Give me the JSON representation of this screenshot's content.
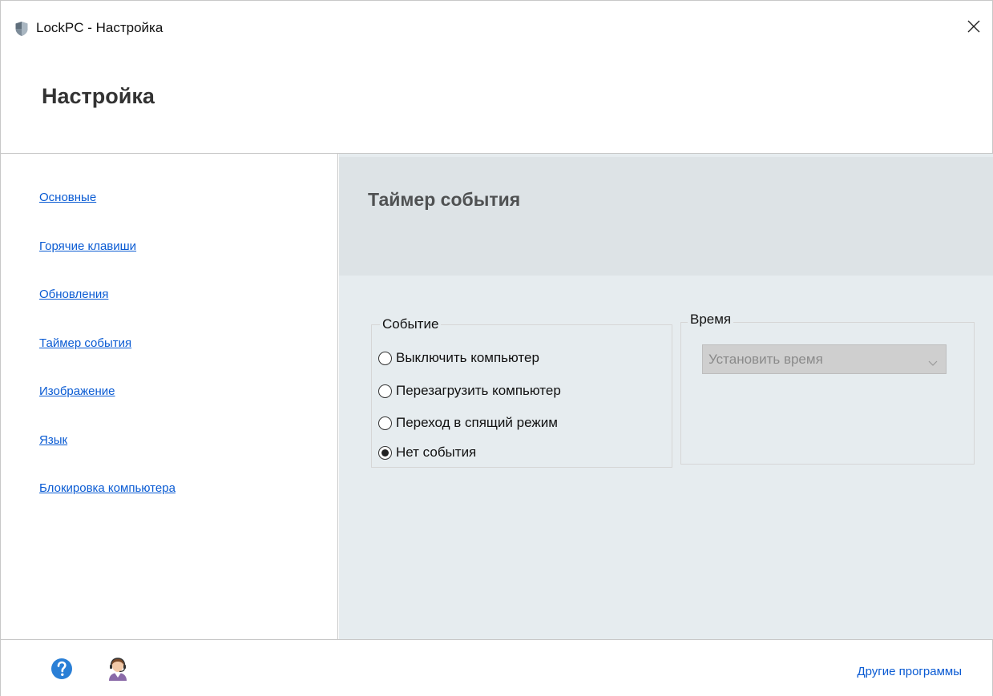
{
  "window": {
    "title": "LockPC - Настройка",
    "header": "Настройка"
  },
  "sidebar": {
    "items": [
      {
        "label": "Основные"
      },
      {
        "label": "Горячие клавиши"
      },
      {
        "label": "Обновления"
      },
      {
        "label": "Таймер события"
      },
      {
        "label": "Изображение"
      },
      {
        "label": "Язык"
      },
      {
        "label": "Блокировка компьютера"
      }
    ]
  },
  "main": {
    "title": "Таймер события",
    "event_group": {
      "label": "Событие",
      "options": [
        {
          "label": "Выключить компьютер",
          "selected": false
        },
        {
          "label": "Перезагрузить компьютер",
          "selected": false
        },
        {
          "label": "Переход в спящий режим",
          "selected": false
        },
        {
          "label": "Нет события",
          "selected": true
        }
      ]
    },
    "time_group": {
      "label": "Время",
      "select_value": "Установить время",
      "enabled": false
    }
  },
  "footer": {
    "other_programs": "Другие программы"
  },
  "icons": {
    "app": "shield-icon",
    "close": "close-icon",
    "help": "help-icon",
    "support": "support-agent-icon"
  },
  "colors": {
    "link": "#0a5bd3",
    "panel_bg": "#e6ecef",
    "panel_header_bg": "#dde3e6",
    "help_blue": "#2a7fd6"
  }
}
